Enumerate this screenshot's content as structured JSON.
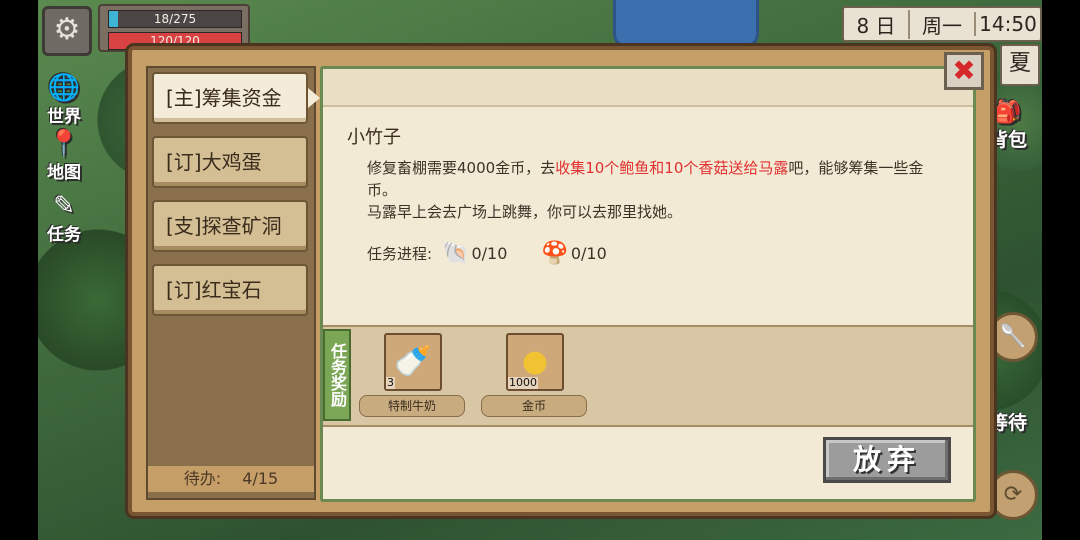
{
  "hud": {
    "energy_text": "18/275",
    "energy_fraction": 0.065,
    "health_text": "120/120",
    "health_fraction": 1.0,
    "day": "8 日",
    "weekday": "周一",
    "time": "14:50",
    "season": "夏",
    "settings_icon": "gear-icon"
  },
  "left_nav": [
    {
      "label": "世界",
      "icon": "world-icon"
    },
    {
      "label": "地图",
      "icon": "map-pin-icon"
    },
    {
      "label": "任务",
      "icon": "quest-icon"
    }
  ],
  "right_nav": {
    "bag_label": "背包",
    "wait_label": "等待"
  },
  "quest_tabs": [
    {
      "label": "[主]筹集资金",
      "active": true
    },
    {
      "label": "[订]大鸡蛋",
      "active": false
    },
    {
      "label": "[支]探查矿洞",
      "active": false
    },
    {
      "label": "[订]红宝石",
      "active": false
    }
  ],
  "pending": {
    "label": "待办:",
    "value": "4/15"
  },
  "quest": {
    "npc": "小竹子",
    "desc_part1": "修复畜棚需要4000金币，去",
    "desc_highlight": "收集10个鲍鱼和10个香菇送给马露",
    "desc_part2": "吧，能够筹集一些金币。",
    "desc_line2": "马露早上会去广场上跳舞，你可以去那里找她。",
    "progress_label": "任务进程:",
    "progress_items": [
      {
        "icon": "abalone-icon",
        "value": "0/10"
      },
      {
        "icon": "mushroom-icon",
        "value": "0/10"
      }
    ]
  },
  "rewards": {
    "label": "任务奖励",
    "items": [
      {
        "name": "特制牛奶",
        "qty": "3",
        "icon": "milk-bottle-icon"
      },
      {
        "name": "金币",
        "qty": "1000",
        "icon": "gold-coin-icon"
      }
    ]
  },
  "buttons": {
    "abandon": "放弃",
    "close_icon": "close-icon"
  },
  "colors": {
    "highlight": "#e03030",
    "energy": "#3fb3d3",
    "health": "#d94243",
    "reward_label_bg": "#7ba656"
  }
}
